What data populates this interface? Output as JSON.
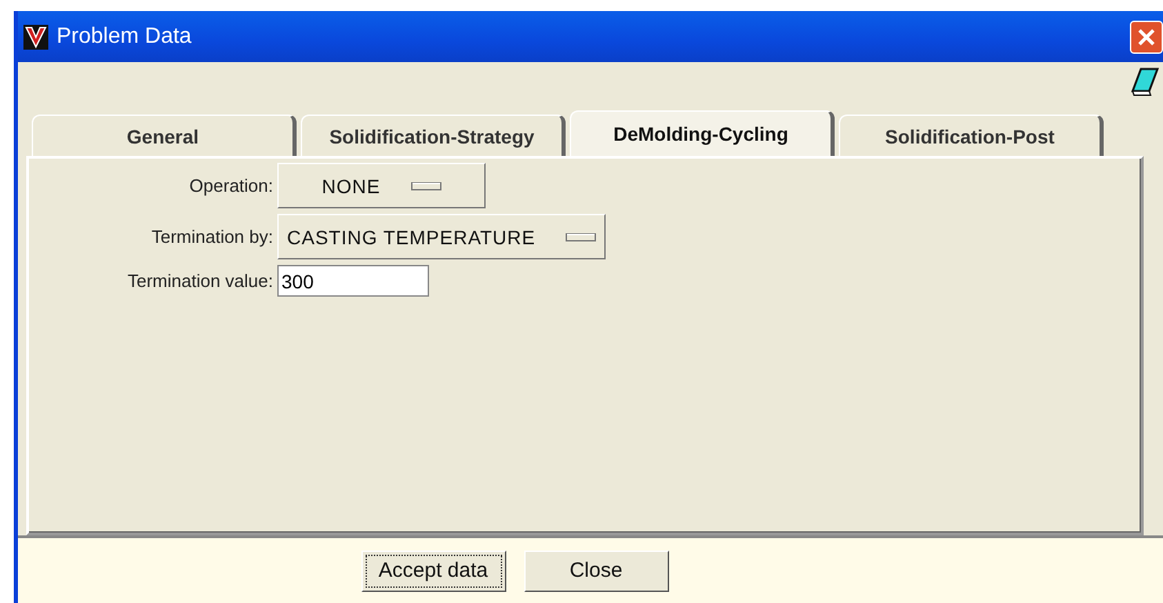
{
  "window": {
    "title": "Problem Data"
  },
  "tabs": [
    {
      "label": "General",
      "selected": false
    },
    {
      "label": "Solidification-Strategy",
      "selected": false
    },
    {
      "label": "DeMolding-Cycling",
      "selected": true
    },
    {
      "label": "Solidification-Post",
      "selected": false
    }
  ],
  "fields": [
    {
      "kind": "dropdown",
      "label": "Operation:",
      "value": "NONE"
    },
    {
      "kind": "dropdown",
      "label": "Termination by:",
      "value": "CASTING TEMPERATURE"
    },
    {
      "kind": "text",
      "label": "Termination value:",
      "value": "300"
    }
  ],
  "buttons": [
    {
      "label": "Accept data",
      "focused": true
    },
    {
      "label": "Close",
      "focused": false
    }
  ]
}
